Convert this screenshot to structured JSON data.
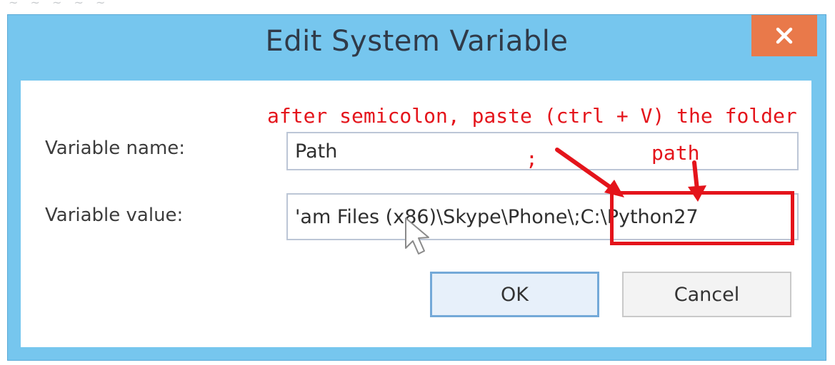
{
  "dialog": {
    "title": "Edit System Variable",
    "close_icon": "close-x-icon",
    "accent_colors": {
      "titlebar": "#76c6ee",
      "close_button": "#e9794a",
      "annotation": "#e4141b"
    }
  },
  "form": {
    "variable_name_label": "Variable name:",
    "variable_name_value": "Path",
    "variable_value_label": "Variable value:",
    "variable_value_value": "'am Files (x86)\\Skype\\Phone\\;C:\\Python27"
  },
  "buttons": {
    "ok_label": "OK",
    "cancel_label": "Cancel"
  },
  "annotations": {
    "instruction_line1": "after semicolon, paste (ctrl + V) the folder",
    "instruction_line2": "path",
    "semicolon_marker": ";"
  }
}
